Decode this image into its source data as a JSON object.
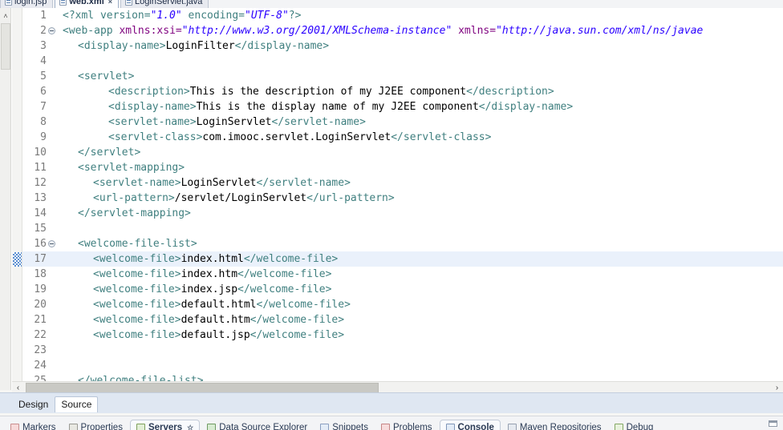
{
  "editor_tabs": [
    {
      "label": "login.jsp",
      "icon": "jsp-file-icon",
      "active": false,
      "closable": false
    },
    {
      "label": "web.xml",
      "icon": "xml-file-icon",
      "active": true,
      "closable": true,
      "close": "×"
    },
    {
      "label": "LoginServlet.java",
      "icon": "java-file-icon",
      "active": false,
      "closable": false
    }
  ],
  "editor": {
    "filename": "web.xml",
    "highlighted_line": 17,
    "fold_lines": [
      2,
      16
    ],
    "lines": [
      {
        "no": "1",
        "indent": 0,
        "parts": [
          {
            "t": "<?xml version=",
            "c": "pi"
          },
          {
            "t": "\"1.0\"",
            "c": "val"
          },
          {
            "t": " encoding=",
            "c": "pi"
          },
          {
            "t": "\"UTF-8\"",
            "c": "val"
          },
          {
            "t": "?>",
            "c": "pi"
          }
        ]
      },
      {
        "no": "2",
        "indent": 0,
        "parts": [
          {
            "t": "<web-app ",
            "c": "tag"
          },
          {
            "t": "xmlns:xsi=",
            "c": "attr"
          },
          {
            "t": "\"http://www.w3.org/2001/XMLSchema-instance\"",
            "c": "val"
          },
          {
            "t": " ",
            "c": "txt"
          },
          {
            "t": "xmlns=",
            "c": "attr"
          },
          {
            "t": "\"http://java.sun.com/xml/ns/javae",
            "c": "val"
          }
        ]
      },
      {
        "no": "3",
        "indent": 1,
        "parts": [
          {
            "t": "<display-name>",
            "c": "tag"
          },
          {
            "t": "LoginFilter",
            "c": "txt"
          },
          {
            "t": "</display-name>",
            "c": "tag"
          }
        ]
      },
      {
        "no": "4",
        "indent": 0,
        "parts": []
      },
      {
        "no": "5",
        "indent": 1,
        "parts": [
          {
            "t": "<servlet>",
            "c": "tag"
          }
        ]
      },
      {
        "no": "6",
        "indent": 3,
        "parts": [
          {
            "t": "<description>",
            "c": "tag"
          },
          {
            "t": "This is the description of my J2EE component",
            "c": "txt"
          },
          {
            "t": "</description>",
            "c": "tag"
          }
        ]
      },
      {
        "no": "7",
        "indent": 3,
        "parts": [
          {
            "t": "<display-name>",
            "c": "tag"
          },
          {
            "t": "This is the display name of my J2EE component",
            "c": "txt"
          },
          {
            "t": "</display-name>",
            "c": "tag"
          }
        ]
      },
      {
        "no": "8",
        "indent": 3,
        "parts": [
          {
            "t": "<servlet-name>",
            "c": "tag"
          },
          {
            "t": "LoginServlet",
            "c": "txt"
          },
          {
            "t": "</servlet-name>",
            "c": "tag"
          }
        ]
      },
      {
        "no": "9",
        "indent": 3,
        "parts": [
          {
            "t": "<servlet-class>",
            "c": "tag"
          },
          {
            "t": "com.imooc.servlet.LoginServlet",
            "c": "txt"
          },
          {
            "t": "</servlet-class>",
            "c": "tag"
          }
        ]
      },
      {
        "no": "10",
        "indent": 1,
        "parts": [
          {
            "t": "</servlet>",
            "c": "tag"
          }
        ]
      },
      {
        "no": "11",
        "indent": 1,
        "parts": [
          {
            "t": "<servlet-mapping>",
            "c": "tag"
          }
        ]
      },
      {
        "no": "12",
        "indent": 2,
        "parts": [
          {
            "t": "<servlet-name>",
            "c": "tag"
          },
          {
            "t": "LoginServlet",
            "c": "txt"
          },
          {
            "t": "</servlet-name>",
            "c": "tag"
          }
        ]
      },
      {
        "no": "13",
        "indent": 2,
        "parts": [
          {
            "t": "<url-pattern>",
            "c": "tag"
          },
          {
            "t": "/servlet/LoginServlet",
            "c": "txt"
          },
          {
            "t": "</url-pattern>",
            "c": "tag"
          }
        ]
      },
      {
        "no": "14",
        "indent": 1,
        "parts": [
          {
            "t": "</servlet-mapping>",
            "c": "tag"
          }
        ]
      },
      {
        "no": "15",
        "indent": 0,
        "parts": []
      },
      {
        "no": "16",
        "indent": 1,
        "parts": [
          {
            "t": "<welcome-file-list>",
            "c": "tag"
          }
        ]
      },
      {
        "no": "17",
        "indent": 2,
        "parts": [
          {
            "t": "<welcome-file>",
            "c": "tag"
          },
          {
            "t": "index.html",
            "c": "txt"
          },
          {
            "t": "</welcome-file>",
            "c": "tag"
          }
        ]
      },
      {
        "no": "18",
        "indent": 2,
        "parts": [
          {
            "t": "<welcome-file>",
            "c": "tag"
          },
          {
            "t": "index.htm",
            "c": "txt"
          },
          {
            "t": "</welcome-file>",
            "c": "tag"
          }
        ]
      },
      {
        "no": "19",
        "indent": 2,
        "parts": [
          {
            "t": "<welcome-file>",
            "c": "tag"
          },
          {
            "t": "index.jsp",
            "c": "txt"
          },
          {
            "t": "</welcome-file>",
            "c": "tag"
          }
        ]
      },
      {
        "no": "20",
        "indent": 2,
        "parts": [
          {
            "t": "<welcome-file>",
            "c": "tag"
          },
          {
            "t": "default.html",
            "c": "txt"
          },
          {
            "t": "</welcome-file>",
            "c": "tag"
          }
        ]
      },
      {
        "no": "21",
        "indent": 2,
        "parts": [
          {
            "t": "<welcome-file>",
            "c": "tag"
          },
          {
            "t": "default.htm",
            "c": "txt"
          },
          {
            "t": "</welcome-file>",
            "c": "tag"
          }
        ]
      },
      {
        "no": "22",
        "indent": 2,
        "parts": [
          {
            "t": "<welcome-file>",
            "c": "tag"
          },
          {
            "t": "default.jsp",
            "c": "txt"
          },
          {
            "t": "</welcome-file>",
            "c": "tag"
          }
        ]
      },
      {
        "no": "23",
        "indent": 0,
        "parts": []
      },
      {
        "no": "24",
        "indent": 0,
        "parts": []
      },
      {
        "no": "25",
        "indent": 1,
        "parts": [
          {
            "t": "</welcome-file-list>",
            "c": "tag"
          }
        ]
      }
    ]
  },
  "scrollbars": {
    "horizontal_left_arrow": "‹",
    "horizontal_right_arrow": "›",
    "vertical_up_arrow": "˄"
  },
  "editor_mode_tabs": [
    {
      "label": "Design",
      "active": false
    },
    {
      "label": "Source",
      "active": true
    }
  ],
  "view_tabs": [
    {
      "label": "Markers",
      "icon": "markers-icon",
      "icon_class": "vi-markers",
      "active": false
    },
    {
      "label": "Properties",
      "icon": "properties-icon",
      "icon_class": "vi-props",
      "active": false
    },
    {
      "label": "Servers",
      "icon": "servers-icon",
      "icon_class": "vi-servers",
      "active": true,
      "pin": "☆"
    },
    {
      "label": "Data Source Explorer",
      "icon": "data-source-explorer-icon",
      "icon_class": "vi-dse",
      "active": false
    },
    {
      "label": "Snippets",
      "icon": "snippets-icon",
      "icon_class": "vi-snippets",
      "active": false
    },
    {
      "label": "Problems",
      "icon": "problems-icon",
      "icon_class": "vi-problems",
      "active": false
    },
    {
      "label": "Console",
      "icon": "console-icon",
      "icon_class": "vi-console",
      "active": true,
      "bold": true
    },
    {
      "label": "Maven Repositories",
      "icon": "maven-repositories-icon",
      "icon_class": "vi-maven",
      "active": false
    },
    {
      "label": "Debug",
      "icon": "debug-icon",
      "icon_class": "vi-debug",
      "active": false
    }
  ],
  "colors": {
    "tag": "#3f7f7f",
    "attribute": "#7f007f",
    "value": "#2a00ff",
    "text": "#000000",
    "highlight_line": "#eaf1fb",
    "diff_marker": "#5b8fd1"
  }
}
